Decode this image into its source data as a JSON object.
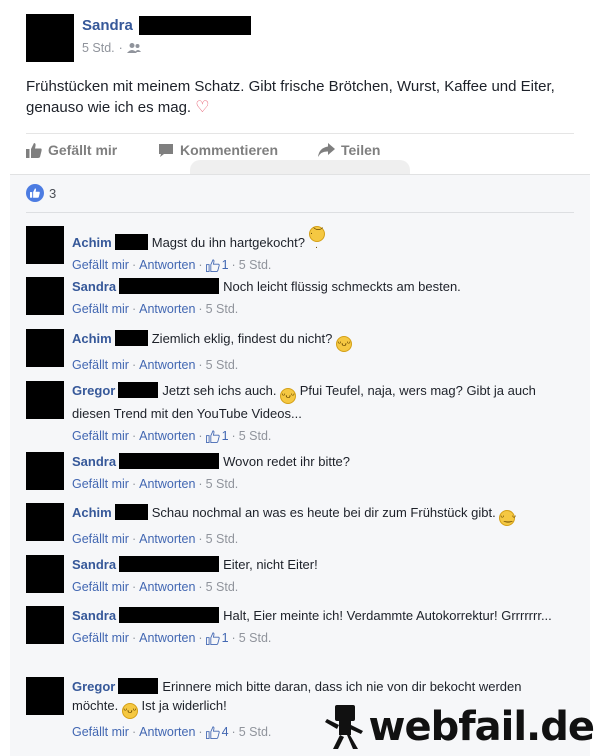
{
  "post": {
    "author": "Sandra",
    "time": "5 Std.",
    "text": "Frühstücken mit meinem Schatz. Gibt frische Brötchen, Wurst, Kaffee und Eiter, genauso wie ich es mag.",
    "reaction_count": "3"
  },
  "actions": {
    "like": "Gefällt mir",
    "comment": "Kommentieren",
    "share": "Teilen"
  },
  "comment_actions": {
    "like": "Gefällt mir",
    "reply": "Antworten"
  },
  "comments": [
    {
      "name": "Achim",
      "text": "Magst du ihn hartgekocht?",
      "emoji": "confused",
      "likes": "1",
      "time": "5 Std."
    },
    {
      "name": "Sandra",
      "text": "Noch leicht flüssig schmeckts am besten.",
      "likes": "",
      "time": "5 Std."
    },
    {
      "name": "Achim",
      "text": "Ziemlich eklig, findest du nicht?",
      "emoji": "grin",
      "likes": "",
      "time": "5 Std."
    },
    {
      "name": "Gregor",
      "text": "Jetzt seh ichs auch.",
      "text2": "Pfui Teufel, naja, wers mag? Gibt ja auch diesen Trend mit den YouTube Videos...",
      "likes": "1",
      "time": "5 Std."
    },
    {
      "name": "Sandra",
      "text": "Wovon redet ihr bitte?",
      "likes": "",
      "time": "5 Std."
    },
    {
      "name": "Achim",
      "text": "Schau nochmal an was es heute bei dir zum Frühstück gibt.",
      "emoji": "smile",
      "likes": "",
      "time": "5 Std."
    },
    {
      "name": "Sandra",
      "text": "Eiter, nicht Eiter!",
      "likes": "",
      "time": "5 Std."
    },
    {
      "name": "Sandra",
      "text": "Halt, Eier meinte ich! Verdammte Autokorrektur! Grrrrrrr...",
      "likes": "1",
      "time": "5 Std."
    },
    {
      "name": "Gregor",
      "text": "Erinnere mich bitte daran, dass ich nie von dir bekocht werden möchte.",
      "text2": "Ist ja widerlich!",
      "likes": "4",
      "time": "5 Std."
    }
  ],
  "brand": "webfail.de"
}
